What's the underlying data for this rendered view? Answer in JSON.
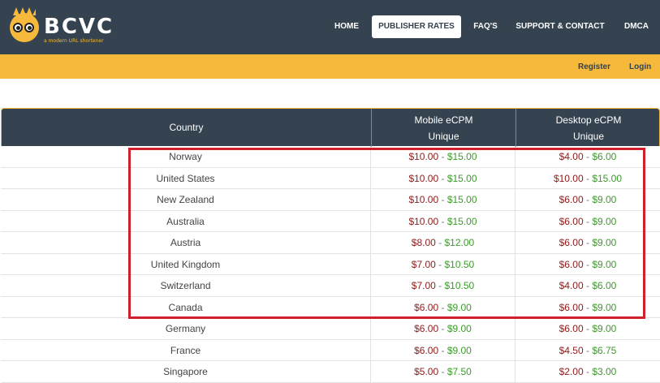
{
  "brand": {
    "name": "BCVC",
    "tagline": "a modern URL shortener"
  },
  "nav": [
    {
      "label": "HOME",
      "active": false
    },
    {
      "label": "PUBLISHER RATES",
      "active": true
    },
    {
      "label": "FAQ'S",
      "active": false
    },
    {
      "label": "SUPPORT & CONTACT",
      "active": false
    },
    {
      "label": "DMCA",
      "active": false
    }
  ],
  "subnav": {
    "register": "Register",
    "login": "Login"
  },
  "table": {
    "headers": {
      "country": "Country",
      "mobile": [
        "Mobile eCPM",
        "Unique"
      ],
      "desktop": [
        "Desktop eCPM",
        "Unique"
      ]
    },
    "rows": [
      {
        "country": "Norway",
        "mobile_lo": "$10.00",
        "mobile_hi": "$15.00",
        "desktop_lo": "$4.00",
        "desktop_hi": "$6.00"
      },
      {
        "country": "United States",
        "mobile_lo": "$10.00",
        "mobile_hi": "$15.00",
        "desktop_lo": "$10.00",
        "desktop_hi": "$15.00"
      },
      {
        "country": "New Zealand",
        "mobile_lo": "$10.00",
        "mobile_hi": "$15.00",
        "desktop_lo": "$6.00",
        "desktop_hi": "$9.00"
      },
      {
        "country": "Australia",
        "mobile_lo": "$10.00",
        "mobile_hi": "$15.00",
        "desktop_lo": "$6.00",
        "desktop_hi": "$9.00"
      },
      {
        "country": "Austria",
        "mobile_lo": "$8.00",
        "mobile_hi": "$12.00",
        "desktop_lo": "$6.00",
        "desktop_hi": "$9.00"
      },
      {
        "country": "United Kingdom",
        "mobile_lo": "$7.00",
        "mobile_hi": "$10.50",
        "desktop_lo": "$6.00",
        "desktop_hi": "$9.00"
      },
      {
        "country": "Switzerland",
        "mobile_lo": "$7.00",
        "mobile_hi": "$10.50",
        "desktop_lo": "$4.00",
        "desktop_hi": "$6.00"
      },
      {
        "country": "Canada",
        "mobile_lo": "$6.00",
        "mobile_hi": "$9.00",
        "desktop_lo": "$6.00",
        "desktop_hi": "$9.00"
      },
      {
        "country": "Germany",
        "mobile_lo": "$6.00",
        "mobile_hi": "$9.00",
        "desktop_lo": "$6.00",
        "desktop_hi": "$9.00"
      },
      {
        "country": "France",
        "mobile_lo": "$6.00",
        "mobile_hi": "$9.00",
        "desktop_lo": "$4.50",
        "desktop_hi": "$6.75"
      },
      {
        "country": "Singapore",
        "mobile_lo": "$5.00",
        "mobile_hi": "$7.50",
        "desktop_lo": "$2.00",
        "desktop_hi": "$3.00"
      }
    ],
    "separator": " - "
  },
  "colors": {
    "header_bg": "#34434f",
    "accent": "#f6b93b",
    "low_value": "#8e1b1b",
    "high_value": "#3c9a2b",
    "highlight_box": "#d0202b"
  }
}
